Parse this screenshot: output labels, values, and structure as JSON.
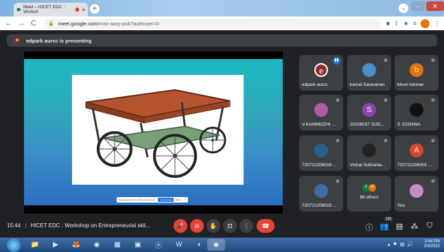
{
  "browser": {
    "tab_title": "Meet – HICET EDC : Worksh",
    "tab_close": "×",
    "new_tab": "+",
    "url_host": "meet.google.com",
    "url_path": "/mxx-aarp-puk?authuser=0",
    "back": "←",
    "forward": "→",
    "reload": "C"
  },
  "presenting_banner": {
    "avatar_letter": "e",
    "text": "edpark aurcc is presenting"
  },
  "slide": {
    "share_text": "meet.google.com is sharing your screen.",
    "stop_sharing": "Stop sharing",
    "hide": "Hide"
  },
  "participants": [
    {
      "name": "edpark aurcc",
      "avatar": "e",
      "color": "#8b2d2d",
      "speaking": true
    },
    {
      "name": "kamal Saravanan",
      "avatar": "",
      "color": "#4a90c8",
      "muted": true
    },
    {
      "name": "bhuvi kannan",
      "avatar": "b",
      "color": "#e8710a",
      "muted": true
    },
    {
      "name": "V.KANIMOZHI ...",
      "avatar": "",
      "color": "#b05aa8",
      "muted": true
    },
    {
      "name": "20206037 SUD...",
      "avatar": "S",
      "color": "#8e44ad",
      "muted": true
    },
    {
      "name": "S JOSHWA",
      "avatar": "",
      "color": "#111111",
      "muted": true
    },
    {
      "name": "720721206016 ...",
      "avatar": "",
      "color": "#2b5f8a",
      "muted": true
    },
    {
      "name": "Vishal Subrama...",
      "avatar": "",
      "color": "#222222",
      "muted": true
    },
    {
      "name": "720721206001 ...",
      "avatar": "A",
      "color": "#d9482b",
      "muted": true
    },
    {
      "name": "720721206015 ...",
      "avatar": "",
      "color": "#3a6ea5",
      "muted": true
    },
    {
      "name": "89 others",
      "avatar": "",
      "color": "#3c4043",
      "muted": false
    },
    {
      "name": "You",
      "avatar": "",
      "color": "#c58ac8",
      "muted": true
    }
  ],
  "others_avatars": [
    "Y",
    "H"
  ],
  "bottom_bar": {
    "time": "15:44",
    "separator": "|",
    "meeting_title": "HICET EDC : Workshop on Entrepreneurial skil...",
    "participant_count": "101"
  },
  "taskbar": {
    "time": "3:44 PM",
    "date": "2/3/2022"
  },
  "colors": {
    "meet_bg": "#202124",
    "tile_bg": "#3c4043",
    "end_call": "#ea4335",
    "accent": "#1a73e8"
  }
}
